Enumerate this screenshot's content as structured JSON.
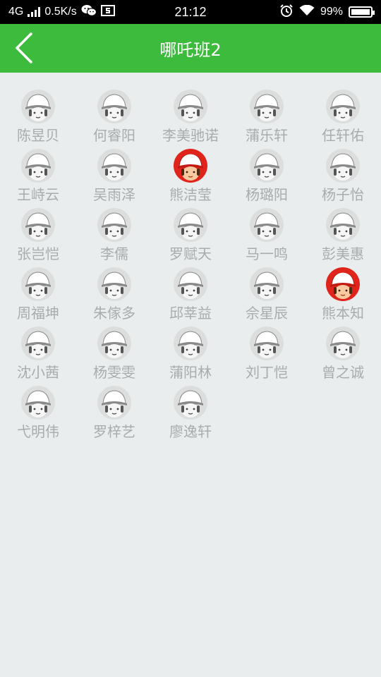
{
  "status_bar": {
    "network": "4G",
    "speed": "0.5K/s",
    "time": "21:12",
    "battery": "99%",
    "battery_level": 0.99
  },
  "header": {
    "title": "哪吒班2",
    "color": "#3dbb3d"
  },
  "students": [
    {
      "name": "陈昱贝",
      "highlighted": false
    },
    {
      "name": "何睿阳",
      "highlighted": false
    },
    {
      "name": "李美驰诺",
      "highlighted": false
    },
    {
      "name": "蒲乐轩",
      "highlighted": false
    },
    {
      "name": "任轩佑",
      "highlighted": false
    },
    {
      "name": "王峙云",
      "highlighted": false
    },
    {
      "name": "吴雨泽",
      "highlighted": false
    },
    {
      "name": "熊洁莹",
      "highlighted": true
    },
    {
      "name": "杨璐阳",
      "highlighted": false
    },
    {
      "name": "杨子怡",
      "highlighted": false
    },
    {
      "name": "张岂恺",
      "highlighted": false
    },
    {
      "name": "李儒",
      "highlighted": false
    },
    {
      "name": "罗赋天",
      "highlighted": false
    },
    {
      "name": "马一鸣",
      "highlighted": false
    },
    {
      "name": "彭美惠",
      "highlighted": false
    },
    {
      "name": "周福坤",
      "highlighted": false
    },
    {
      "name": "朱傢多",
      "highlighted": false
    },
    {
      "name": "邱莘益",
      "highlighted": false
    },
    {
      "name": "佘星辰",
      "highlighted": false
    },
    {
      "name": "熊本知",
      "highlighted": true
    },
    {
      "name": "沈小茜",
      "highlighted": false
    },
    {
      "name": "杨雯雯",
      "highlighted": false
    },
    {
      "name": "蒲阳林",
      "highlighted": false
    },
    {
      "name": "刘丁恺",
      "highlighted": false
    },
    {
      "name": "曾之诚",
      "highlighted": false
    },
    {
      "name": "弋明伟",
      "highlighted": false
    },
    {
      "name": "罗梓艺",
      "highlighted": false
    },
    {
      "name": "廖逸轩",
      "highlighted": false
    }
  ],
  "colors": {
    "background": "#e9eded",
    "name_text": "#a9acac",
    "avatar_highlight": "#e0241b"
  }
}
